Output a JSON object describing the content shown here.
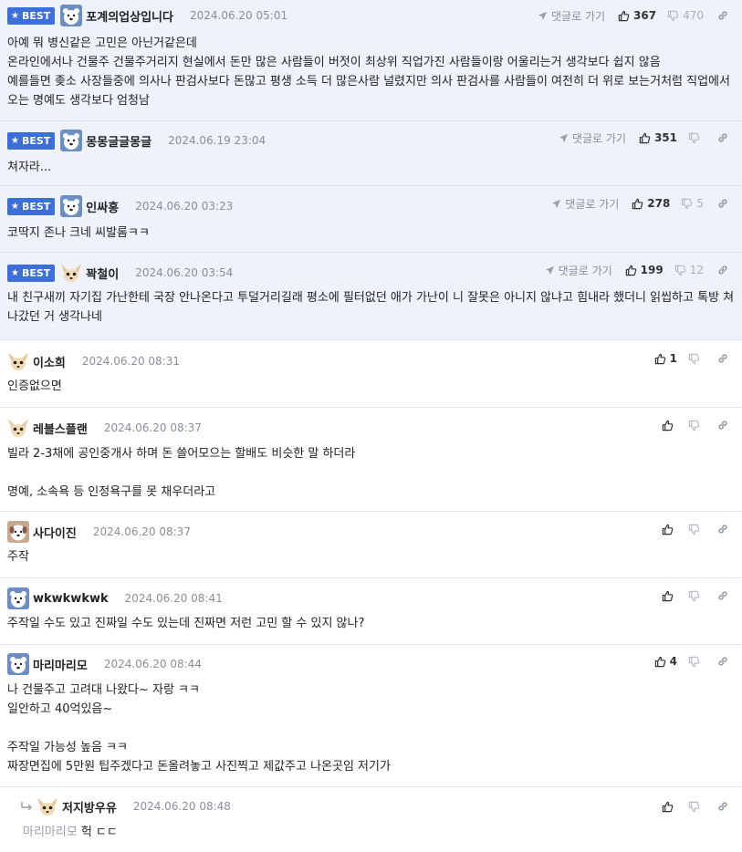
{
  "labels": {
    "best": "BEST",
    "reply_to": "댓글로 가기"
  },
  "colors": {
    "best_bg": "#eef2fb",
    "badge": "#3d6fd8",
    "separator": "#e2e5ea",
    "muted": "#8a8f97"
  },
  "comments": [
    {
      "best": true,
      "avatar": "polar-bear-avatar",
      "nick": "포계의업상입니다",
      "date": "2024.06.20 05:01",
      "likes": "367",
      "dislikes": "470",
      "body": "아예 뭐 병신같은 고민은 아닌거같은데\n온라인에서나 건물주 건물주거리지 현실에서 돈만 많은 사람들이 버젓이 최상위 직업가진 사람들이랑 어울리는거 생각보다 쉽지 않음\n예를들면 좆소 사장들중에 의사나 판검사보다 돈많고 평생 소득 더 많은사람 널렸지만 의사 판검사를 사람들이 여전히 더 위로 보는거처럼 직업에서 오는 명예도 생각보다 엄청남"
    },
    {
      "best": true,
      "avatar": "polar-bear-avatar",
      "nick": "몽몽글글몽글",
      "date": "2024.06.19 23:04",
      "likes": "351",
      "dislikes": "",
      "body": "쳐자라..."
    },
    {
      "best": true,
      "avatar": "polar-bear-avatar",
      "nick": "인싸흥",
      "date": "2024.06.20 03:23",
      "likes": "278",
      "dislikes": "5",
      "body": "코딱지 존나 크네 씨발롬ㅋㅋ"
    },
    {
      "best": true,
      "avatar": "fennec-avatar",
      "nick": "꽉철이",
      "date": "2024.06.20 03:54",
      "likes": "199",
      "dislikes": "12",
      "body": "내 친구새끼 자기집 가난한테 국장 안나온다고 투덜거리길래 평소에 필터없던 애가 가난이 니 잘못은 아니지 않냐고 힘내라 했더니 읽씹하고 톡방 쳐나갔던 거 생각나네"
    },
    {
      "best": false,
      "avatar": "fennec-avatar",
      "nick": "이소희",
      "date": "2024.06.20 08:31",
      "likes": "1",
      "dislikes": "",
      "body": "인증없으면"
    },
    {
      "best": false,
      "avatar": "fennec-avatar",
      "nick": "레블스플랜",
      "date": "2024.06.20 08:37",
      "likes": "",
      "dislikes": "",
      "body": "빌라 2-3채에 공인중개사 하며 돈 쓸어모으는 할배도 비슷한 말 하더라\n\n명예, 소속욕 등 인정욕구를 못 채우더라고"
    },
    {
      "best": false,
      "avatar": "dog-avatar",
      "nick": "사다이진",
      "date": "2024.06.20 08:37",
      "likes": "",
      "dislikes": "",
      "body": "주작"
    },
    {
      "best": false,
      "avatar": "polar-bear-avatar",
      "nick": "wkwkwkwk",
      "date": "2024.06.20 08:41",
      "likes": "",
      "dislikes": "",
      "body": "주작일 수도 있고 진짜일 수도 있는데 진짜면 저런 고민 할 수 있지 않나?"
    },
    {
      "best": false,
      "avatar": "polar-bear-avatar",
      "nick": "마리마리모",
      "date": "2024.06.20 08:44",
      "likes": "4",
      "dislikes": "",
      "body": "나 건물주고 고려대 나왔다~ 자랑 ㅋㅋ\n일안하고 40억있음~\n\n주작일 가능성 높음 ㅋㅋ\n짜장면집에 5만원 팁주겠다고 돈올려놓고 사진찍고 제값주고 나온곳임 저기가"
    },
    {
      "best": false,
      "reply": true,
      "avatar": "fennec-avatar",
      "nick": "저지방우유",
      "date": "2024.06.20 08:48",
      "likes": "",
      "dislikes": "",
      "reply_parent": "마리마리모",
      "body": "헉 ㄷㄷ"
    }
  ]
}
